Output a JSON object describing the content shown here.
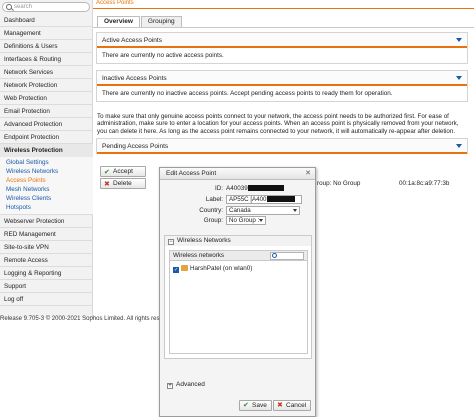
{
  "sidebar": {
    "search_placeholder": "search",
    "items": [
      {
        "label": "Dashboard"
      },
      {
        "label": "Management"
      },
      {
        "label": "Definitions & Users"
      },
      {
        "label": "Interfaces & Routing"
      },
      {
        "label": "Network Services"
      },
      {
        "label": "Network Protection"
      },
      {
        "label": "Web Protection"
      },
      {
        "label": "Email Protection"
      },
      {
        "label": "Advanced Protection"
      },
      {
        "label": "Endpoint Protection"
      },
      {
        "label": "Wireless Protection"
      }
    ],
    "wireless_sub": [
      "Global Settings",
      "Wireless Networks",
      "Access Points",
      "Mesh Networks",
      "Wireless Clients",
      "Hotspots"
    ],
    "items_after": [
      {
        "label": "Webserver Protection"
      },
      {
        "label": "RED Management"
      },
      {
        "label": "Site-to-site VPN"
      },
      {
        "label": "Remote Access"
      },
      {
        "label": "Logging & Reporting"
      },
      {
        "label": "Support"
      },
      {
        "label": "Log off"
      }
    ]
  },
  "header": {
    "title": "Access Points"
  },
  "tabs": [
    "Overview",
    "Grouping"
  ],
  "panels": {
    "active": {
      "title": "Active Access Points",
      "body": "There are currently no active access points."
    },
    "inactive": {
      "title": "Inactive Access Points",
      "body": "There are currently no inactive access points. Accept pending access points to ready them for operation."
    },
    "pending": {
      "title": "Pending Access Points"
    }
  },
  "note": "To make sure that only genuine access points connect to your network, the access point needs to be authorized first. For ease of administration, make sure to enter a location for your access points. When an access point is physically removed from your network, you can delete it here. As long as the access point remains connected to your network, it will automatically re-appear after deletion.",
  "pending_row": {
    "accept_label": "Accept",
    "delete_label": "Delete",
    "group_text": "roup: No Group",
    "mac_text": "00:1a:8c:a9:77:3b"
  },
  "status_bar": "Release 9.705-3  © 2000-2021 Sophos Limited. All rights rese",
  "dialog": {
    "title": "Edit Access Point",
    "id_label": "ID:",
    "id_value": "A40039",
    "label_label": "Label:",
    "label_value": "AP55C [A400",
    "country_label": "Country:",
    "country_value": "Canada",
    "group_label": "Group:",
    "group_value": "No Group :",
    "wireless_section": "Wireless Networks",
    "wireless_list_header": "Wireless networks",
    "wireless_item": "HarshPatel (on wlan0)",
    "advanced_section": "Advanced",
    "save_label": "Save",
    "cancel_label": "Cancel"
  },
  "colors": {
    "accent": "#e8730c",
    "link": "#1a5aa8"
  }
}
